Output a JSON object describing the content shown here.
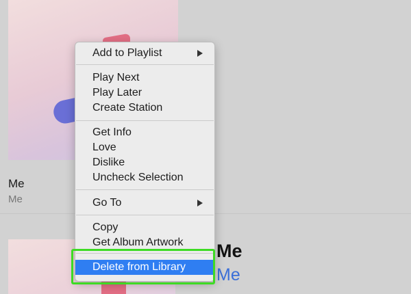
{
  "album": {
    "title": "Me",
    "artist": "Me"
  },
  "detail": {
    "title": "Me",
    "artist": "Me",
    "meta": ""
  },
  "context_menu": {
    "add_to_playlist": "Add to Playlist",
    "play_next": "Play Next",
    "play_later": "Play Later",
    "create_station": "Create Station",
    "get_info": "Get Info",
    "love": "Love",
    "dislike": "Dislike",
    "uncheck_selection": "Uncheck Selection",
    "go_to": "Go To",
    "copy": "Copy",
    "get_album_artwork": "Get Album Artwork",
    "delete_from_library": "Delete from Library"
  },
  "colors": {
    "highlight": "#2f7ef2",
    "callout": "#3ddb24",
    "artist_link": "#3b6fd8"
  },
  "icons": {
    "submenu": "chevron-right-icon"
  }
}
